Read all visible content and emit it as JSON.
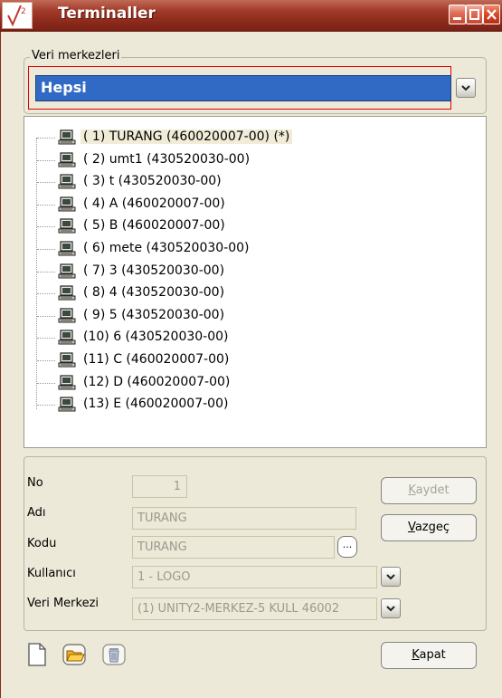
{
  "window": {
    "title": "Terminaller"
  },
  "group": {
    "legend": "Veri merkezleri",
    "selected": "Hepsi"
  },
  "tree": {
    "items": [
      {
        "label": "( 1) TURANG (460020007-00)  (*)",
        "selected": true
      },
      {
        "label": "( 2) umt1 (430520030-00)"
      },
      {
        "label": "( 3) t (430520030-00)"
      },
      {
        "label": "( 4) A (460020007-00)"
      },
      {
        "label": "( 5) B (460020007-00)"
      },
      {
        "label": "( 6) mete (430520030-00)"
      },
      {
        "label": "( 7) 3 (430520030-00)"
      },
      {
        "label": "( 8) 4 (430520030-00)"
      },
      {
        "label": "( 9) 5 (430520030-00)"
      },
      {
        "label": "(10) 6 (430520030-00)"
      },
      {
        "label": "(11) C (460020007-00)"
      },
      {
        "label": "(12) D (460020007-00)"
      },
      {
        "label": "(13) E (460020007-00)"
      }
    ]
  },
  "form": {
    "no_label": "No",
    "no_value": "1",
    "adi_label": "Adı",
    "adi_value": "TURANG",
    "kodu_label": "Kodu",
    "kodu_value": "TURANG",
    "ellipsis": "...",
    "kullanici_label": "Kullanıcı",
    "kullanici_value": "1 - LOGO",
    "veri_merkezi_label": "Veri Merkezi",
    "veri_merkezi_value": "(1) UNITY2-MERKEZ-5 KULL 46002"
  },
  "buttons": {
    "kaydet": {
      "first": "K",
      "rest": "aydet"
    },
    "vazgec": {
      "first": "V",
      "rest": "azgeç"
    },
    "kapat": {
      "first": "K",
      "rest": "apat"
    }
  },
  "icons": {
    "titlebar": [
      "minimize-icon",
      "maximize-icon",
      "close-icon"
    ],
    "bottom": [
      "new-document-icon",
      "open-folder-icon",
      "delete-trash-icon"
    ],
    "tree": "computer-icon"
  },
  "colors": {
    "titlebar": "#a23a2a",
    "selection": "#316ac5",
    "highlight_border": "#e00000"
  }
}
